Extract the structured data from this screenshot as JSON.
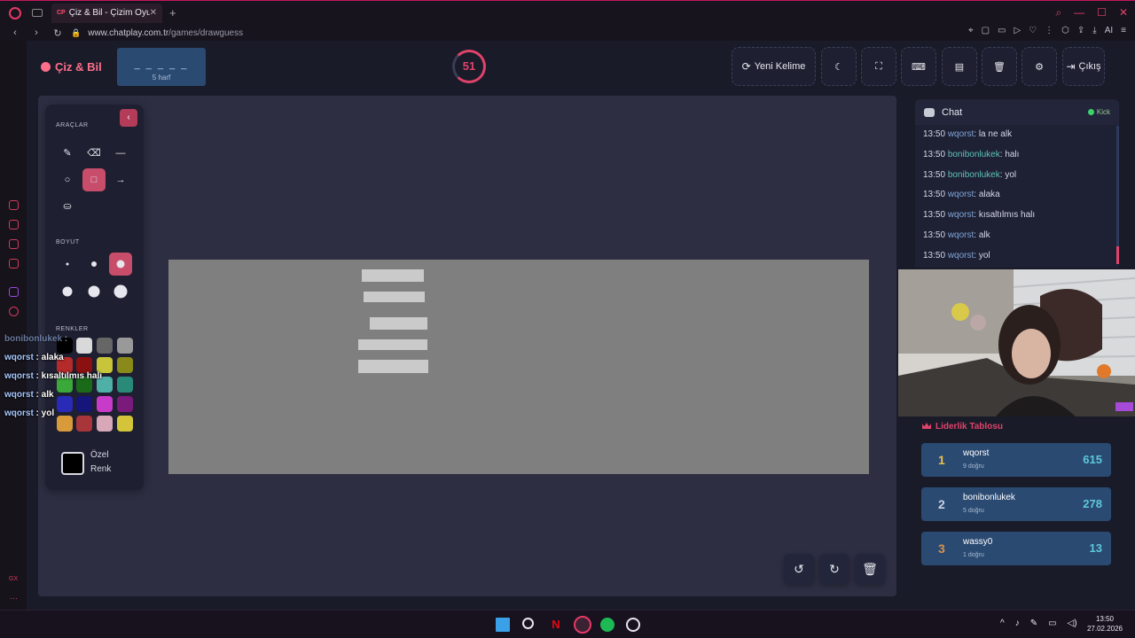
{
  "browser": {
    "tab_title": "Çiz & Bil - Çizim Oyunu",
    "tab_favicon": "CP",
    "url_host": "www.chatplay.com.tr",
    "url_path": "/games/drawguess",
    "ai_label": "AI"
  },
  "header": {
    "logo": "Çiz & Bil",
    "word_mask": "_ _ _ _ _",
    "word_hint": "5 harf",
    "timer": "51",
    "new_word_label": "Yeni Kelime",
    "exit_label": "Çıkış"
  },
  "tools": {
    "title": "ARAÇLAR",
    "size_title": "BOYUT",
    "colors_title": "RENKLER",
    "custom_label": "Özel",
    "custom_label2": "Renk",
    "items": [
      "pencil-icon",
      "eraser-icon",
      "line-icon",
      "circle-icon",
      "square-icon",
      "arrow-icon",
      "bucket-icon"
    ],
    "active_tool": "square-icon",
    "active_size_index": 2,
    "colors": [
      "#000000",
      "#d9d9d9",
      "#666666",
      "#999999",
      "#b52a2a",
      "#8b1010",
      "#c8c53a",
      "#8a8a1a",
      "#3aa83a",
      "#1a6a1a",
      "#4fb0a8",
      "#2a8a7a",
      "#2a2ab8",
      "#15157a",
      "#c83ac8",
      "#7a1a7a",
      "#d89a3a",
      "#a8353a",
      "#d8a8b8",
      "#d4c43a"
    ]
  },
  "overlay_chat": [
    {
      "user": "bonibonlukek",
      "text": ""
    },
    {
      "user": "wqorst",
      "text": "alaka"
    },
    {
      "user": "wqorst",
      "text": "kısaltılmıs halı"
    },
    {
      "user": "wqorst",
      "text": "alk"
    },
    {
      "user": "wqorst",
      "text": "yol"
    }
  ],
  "chat": {
    "title": "Chat",
    "platform": "Kick",
    "messages": [
      {
        "time": "13:50",
        "user": "wqorst",
        "text": "la ne alk"
      },
      {
        "time": "13:50",
        "user": "bonibonlukek",
        "text": "halı"
      },
      {
        "time": "13:50",
        "user": "bonibonlukek",
        "text": "yol"
      },
      {
        "time": "13:50",
        "user": "wqorst",
        "text": "alaka"
      },
      {
        "time": "13:50",
        "user": "wqorst",
        "text": "kısaltılmıs halı"
      },
      {
        "time": "13:50",
        "user": "wqorst",
        "text": "alk"
      },
      {
        "time": "13:50",
        "user": "wqorst",
        "text": "yol"
      }
    ]
  },
  "leaderboard": {
    "title": "Liderlik Tablosu",
    "rows": [
      {
        "rank": "1",
        "name": "wqorst",
        "sub": "9 doğru",
        "points": "615",
        "rank_color": "#e8c14a"
      },
      {
        "rank": "2",
        "name": "bonibonlukek",
        "sub": "5 doğru",
        "points": "278",
        "rank_color": "#c9d2e0"
      },
      {
        "rank": "3",
        "name": "wassy0",
        "sub": "1 doğru",
        "points": "13",
        "rank_color": "#d8924a"
      }
    ]
  },
  "taskbar": {
    "time": "13:50",
    "date": "27.02.2026"
  },
  "colors": {
    "accent": "#e0436a",
    "panel": "#1e2032",
    "leader_row": "#2a4a72"
  }
}
